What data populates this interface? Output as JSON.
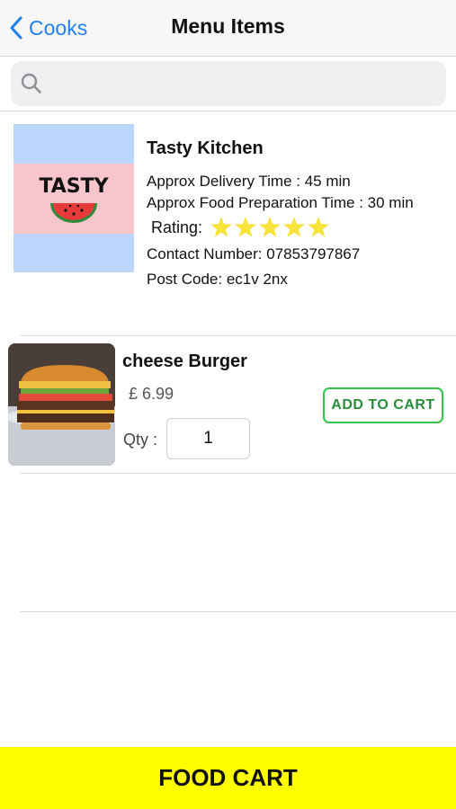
{
  "nav": {
    "back_label": "Cooks",
    "title": "Menu Items"
  },
  "search": {
    "placeholder": "",
    "value": ""
  },
  "restaurant": {
    "name": "Tasty Kitchen",
    "delivery_time": "Approx Delivery Time : 45 min",
    "prep_time": "Approx Food Preparation Time : 30 min",
    "rating_label": "Rating:",
    "rating_value": 5,
    "rating_max": 5,
    "contact": "Contact Number: 07853797867",
    "postcode": "Post Code: ec1v 2nx",
    "logo_text": "TASTY"
  },
  "menu_items": [
    {
      "name": "cheese Burger",
      "price": "£ 6.99",
      "qty_label": "Qty :",
      "qty_value": "1",
      "add_label": "ADD TO CART"
    }
  ],
  "footer": {
    "cart_label": "FOOD CART"
  },
  "colors": {
    "accent_blue": "#1f7ff5",
    "star_yellow": "#f7e33a",
    "add_green": "#33c24a",
    "cart_yellow": "#ffff00"
  }
}
